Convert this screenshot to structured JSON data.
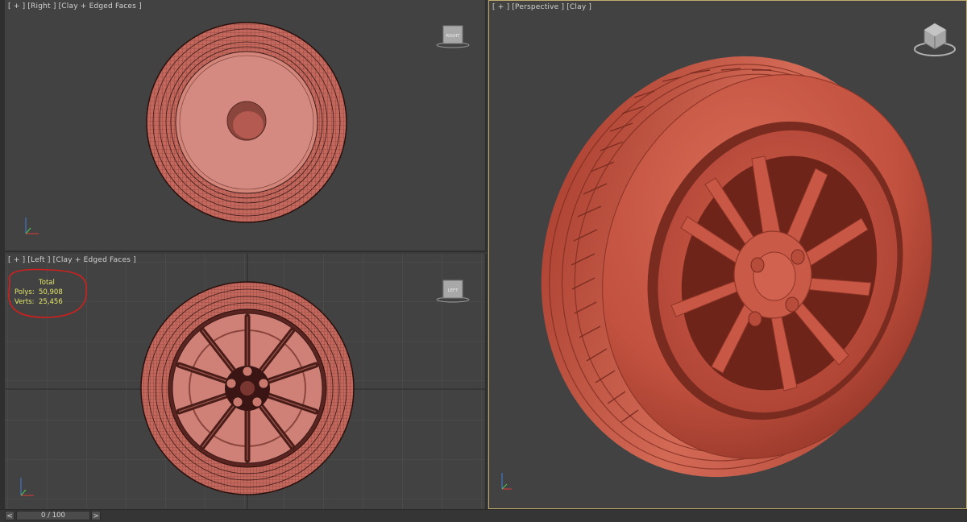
{
  "viewports": {
    "right": {
      "label": "[ + ] [Right ] [Clay + Edged Faces ]",
      "cube_label": "RIGHT"
    },
    "left": {
      "label": "[ + ] [Left ] [Clay + Edged Faces ]",
      "cube_label": "LEFT"
    },
    "perspective": {
      "label": "[ + ] [Perspective ] [Clay ]"
    }
  },
  "stats": {
    "header": "Total",
    "polys_label": "Polys:",
    "polys_value": "50,908",
    "verts_label": "Verts:",
    "verts_value": "25,456"
  },
  "timeline": {
    "frame": "0 / 100",
    "prev": "<",
    "next": ">"
  },
  "colors": {
    "viewport_bg": "#424242",
    "clay": "#c8665a",
    "active_border": "#c2ad6e",
    "stats_text": "#e4e66a",
    "annotation": "#d0201e"
  }
}
